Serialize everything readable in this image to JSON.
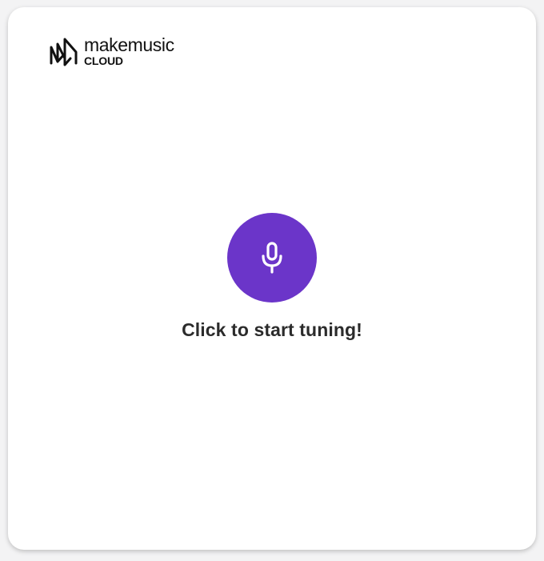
{
  "brand": {
    "primary": "makemusic",
    "secondary": "CLOUD",
    "icon": "makemusic-logo-icon"
  },
  "tuner": {
    "button_icon": "microphone-icon",
    "button_color": "#6b35c9",
    "prompt": "Click to start tuning!"
  }
}
